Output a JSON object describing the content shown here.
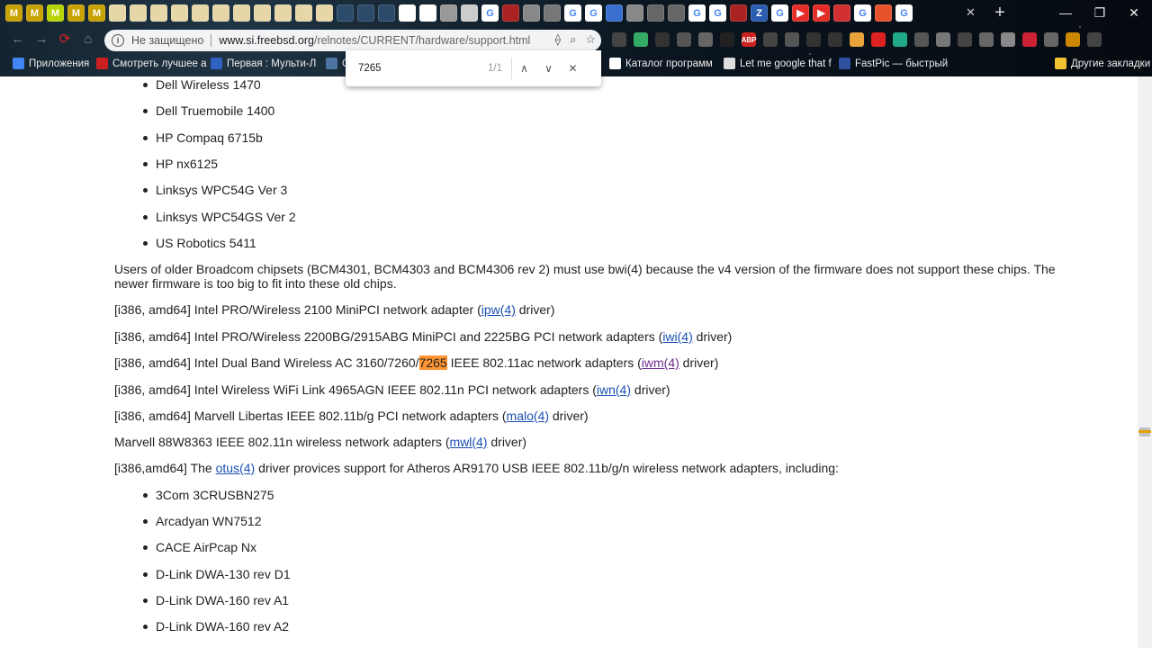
{
  "browser": {
    "tabs_favicons": [
      {
        "icon": "malwarebytes-icon",
        "color": "#c8a200",
        "glyph": "M"
      },
      {
        "icon": "malwarebytes-icon",
        "color": "#c8a200",
        "glyph": "M"
      },
      {
        "icon": "malwarebytes-icon",
        "color": "#b8d400",
        "glyph": "M"
      },
      {
        "icon": "malwarebytes-icon",
        "color": "#c8a200",
        "glyph": "M"
      },
      {
        "icon": "malwarebytes-icon",
        "color": "#c8a200",
        "glyph": "M"
      },
      {
        "icon": "book-icon",
        "color": "#e6d6a8",
        "glyph": ""
      },
      {
        "icon": "book-icon",
        "color": "#e6d6a8",
        "glyph": ""
      },
      {
        "icon": "book-icon",
        "color": "#e6d6a8",
        "glyph": ""
      },
      {
        "icon": "book-icon",
        "color": "#e6d6a8",
        "glyph": ""
      },
      {
        "icon": "book-icon",
        "color": "#e6d6a8",
        "glyph": ""
      },
      {
        "icon": "book-icon",
        "color": "#e6d6a8",
        "glyph": ""
      },
      {
        "icon": "book-icon",
        "color": "#e6d6a8",
        "glyph": ""
      },
      {
        "icon": "book-icon",
        "color": "#e6d6a8",
        "glyph": ""
      },
      {
        "icon": "book-icon",
        "color": "#e6d6a8",
        "glyph": ""
      },
      {
        "icon": "book-icon",
        "color": "#e6d6a8",
        "glyph": ""
      },
      {
        "icon": "book-icon",
        "color": "#e6d6a8",
        "glyph": ""
      },
      {
        "icon": "gear-icon",
        "color": "#2c4a6a",
        "glyph": ""
      },
      {
        "icon": "gear-icon",
        "color": "#2c4a6a",
        "glyph": ""
      },
      {
        "icon": "gear-icon",
        "color": "#2c4a6a",
        "glyph": ""
      },
      {
        "icon": "page-icon",
        "color": "#ffffff",
        "glyph": ""
      },
      {
        "icon": "page-icon",
        "color": "#ffffff",
        "glyph": ""
      },
      {
        "icon": "page-icon",
        "color": "#999999",
        "glyph": ""
      },
      {
        "icon": "page-icon",
        "color": "#cccccc",
        "glyph": ""
      },
      {
        "icon": "google-icon",
        "color": "#ffffff",
        "glyph": "G"
      },
      {
        "icon": "generic-icon",
        "color": "#aa2222",
        "glyph": ""
      },
      {
        "icon": "generic-icon",
        "color": "#888888",
        "glyph": ""
      },
      {
        "icon": "generic-icon",
        "color": "#777777",
        "glyph": ""
      },
      {
        "icon": "google-icon",
        "color": "#ffffff",
        "glyph": "G"
      },
      {
        "icon": "google-icon",
        "color": "#ffffff",
        "glyph": "G"
      },
      {
        "icon": "chat-icon",
        "color": "#3b6fd0",
        "glyph": ""
      },
      {
        "icon": "page-icon",
        "color": "#888888",
        "glyph": ""
      },
      {
        "icon": "generic-icon",
        "color": "#666666",
        "glyph": ""
      },
      {
        "icon": "generic-icon",
        "color": "#666666",
        "glyph": ""
      },
      {
        "icon": "google-icon",
        "color": "#ffffff",
        "glyph": "G"
      },
      {
        "icon": "google-icon",
        "color": "#ffffff",
        "glyph": "G"
      },
      {
        "icon": "generic-icon",
        "color": "#aa2222",
        "glyph": ""
      },
      {
        "icon": "z-icon",
        "color": "#2a5db0",
        "glyph": "Z"
      },
      {
        "icon": "google-icon",
        "color": "#ffffff",
        "glyph": "G"
      },
      {
        "icon": "youtube-icon",
        "color": "#e52d27",
        "glyph": "▶"
      },
      {
        "icon": "youtube-icon",
        "color": "#e52d27",
        "glyph": "▶"
      },
      {
        "icon": "generic-icon",
        "color": "#d03030",
        "glyph": ""
      },
      {
        "icon": "google-icon",
        "color": "#ffffff",
        "glyph": "G"
      },
      {
        "icon": "mail-icon",
        "color": "#e5532d",
        "glyph": ""
      },
      {
        "icon": "google-icon",
        "color": "#ffffff",
        "glyph": "G"
      }
    ],
    "tab_close": "✕",
    "new_tab": "+",
    "window": {
      "minimize": "—",
      "maximize": "❐",
      "close": "✕"
    }
  },
  "toolbar": {
    "back": "←",
    "forward": "→",
    "reload": "⟳",
    "home": "⌂",
    "security_label": "Не защищено",
    "url_host": "www.si.freebsd.org",
    "url_path": "/relnotes/CURRENT/hardware/support.html",
    "bookmark_star": "☆"
  },
  "bookmarks": [
    {
      "label": "Приложения",
      "color": "#4285f4"
    },
    {
      "label": "Смотреть лучшее а",
      "color": "#cc2020"
    },
    {
      "label": "Первая : Мульти-Л",
      "color": "#3060c0"
    },
    {
      "label": "С",
      "color": "#4c75a3"
    },
    {
      "label": "Каталог программ",
      "color": "#ffffff"
    },
    {
      "label": "Let me google that f",
      "color": "#dddddd"
    },
    {
      "label": "FastPic — быстрый",
      "color": "#3050a0"
    },
    {
      "label": "Другие закладки",
      "color": "#f2c230"
    }
  ],
  "find": {
    "query": "7265",
    "count": "1/1",
    "prev": "∧",
    "next": "∨",
    "close": "✕"
  },
  "content": {
    "list1": [
      "Dell Wireless 1470",
      "Dell Truemobile 1400",
      "HP Compaq 6715b",
      "HP nx6125",
      "Linksys WPC54G Ver 3",
      "Linksys WPC54GS Ver 2",
      "US Robotics 5411"
    ],
    "broadcom_note": "Users of older Broadcom chipsets (BCM4301, BCM4303 and BCM4306 rev 2) must use bwi(4) because the v4 version of the firmware does not support these chips. The newer firmware is too big to fit into these old chips.",
    "ipw": {
      "pre": "[i386, amd64] Intel PRO/Wireless 2100 MiniPCI network adapter (",
      "link": "ipw(4)",
      "post": " driver)"
    },
    "iwi": {
      "pre": "[i386, amd64] Intel PRO/Wireless 2200BG/2915ABG MiniPCI and 2225BG PCI network adapters (",
      "link": "iwi(4)",
      "post": " driver)"
    },
    "iwm": {
      "pre": "[i386, amd64] Intel Dual Band Wireless AC 3160/7260/",
      "highlight": "7265",
      "mid": " IEEE 802.11ac network adapters (",
      "link": "iwm(4)",
      "post": " driver)"
    },
    "iwn": {
      "pre": "[i386, amd64] Intel Wireless WiFi Link 4965AGN IEEE 802.11n PCI network adapters (",
      "link": "iwn(4)",
      "post": " driver)"
    },
    "malo": {
      "pre": "[i386, amd64] Marvell Libertas IEEE 802.11b/g PCI network adapters (",
      "link": "malo(4)",
      "post": " driver)"
    },
    "mwl": {
      "pre": "Marvell 88W8363 IEEE 802.11n wireless network adapters (",
      "link": "mwl(4)",
      "post": " driver)"
    },
    "otus": {
      "pre": "[i386,amd64] The ",
      "link": "otus(4)",
      "post": " driver provices support for Atheros AR9170 USB IEEE 802.11b/g/n wireless network adapters, including:"
    },
    "list2": [
      "3Com 3CRUSBN275",
      "Arcadyan WN7512",
      "CACE AirPcap Nx",
      "D-Link DWA-130 rev D1",
      "D-Link DWA-160 rev A1",
      "D-Link DWA-160 rev A2"
    ]
  }
}
